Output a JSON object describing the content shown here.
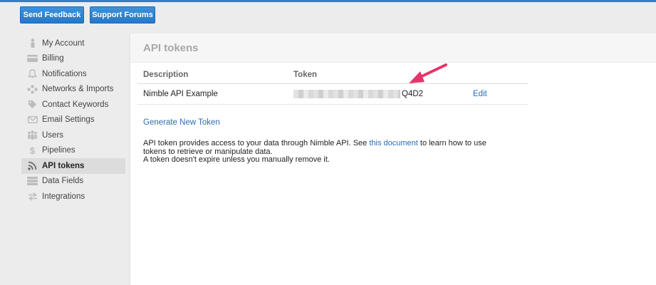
{
  "topbar": {
    "feedback_label": "Send Feedback",
    "forums_label": "Support Forums"
  },
  "sidebar": {
    "items": [
      {
        "label": "My Account",
        "icon": "person-icon"
      },
      {
        "label": "Billing",
        "icon": "credit-card-icon"
      },
      {
        "label": "Notifications",
        "icon": "bell-icon"
      },
      {
        "label": "Networks & Imports",
        "icon": "network-icon"
      },
      {
        "label": "Contact Keywords",
        "icon": "tag-icon"
      },
      {
        "label": "Email Settings",
        "icon": "envelope-icon"
      },
      {
        "label": "Users",
        "icon": "users-icon"
      },
      {
        "label": "Pipelines",
        "icon": "dollar-icon"
      },
      {
        "label": "API tokens",
        "icon": "rss-icon",
        "active": true
      },
      {
        "label": "Data Fields",
        "icon": "data-fields-icon"
      },
      {
        "label": "Integrations",
        "icon": "arrows-icon"
      }
    ]
  },
  "main": {
    "title": "API tokens",
    "table": {
      "headers": {
        "description": "Description",
        "token": "Token"
      },
      "rows": [
        {
          "description": "Nimble API Example",
          "token_suffix": "Q4D2",
          "action": "Edit"
        }
      ]
    },
    "generate_label": "Generate New Token",
    "info": {
      "line1_before": "API token provides access to your data through Nimble API. See ",
      "link": "this document",
      "line1_after": " to learn how to use tokens to retrieve or manipulate data.",
      "line2": "A token doesn't expire unless you manually remove it."
    }
  },
  "colors": {
    "accent_blue": "#2f7fd0",
    "link_blue": "#2a6cb8",
    "annotation_arrow": "#e8336a"
  }
}
